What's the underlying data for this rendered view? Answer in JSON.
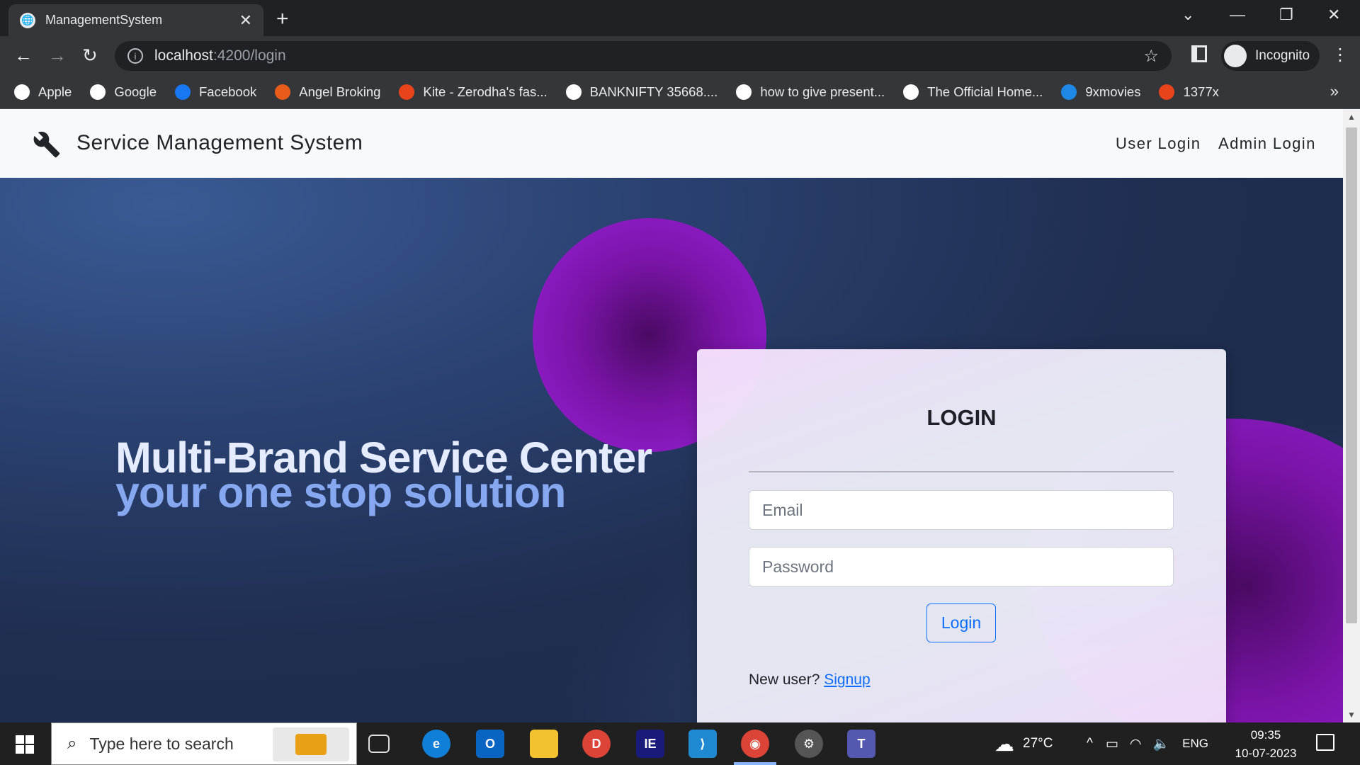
{
  "browser": {
    "tab_title": "ManagementSystem",
    "url_host": "localhost",
    "url_path": ":4200/login",
    "profile_label": "Incognito"
  },
  "bookmarks": [
    {
      "label": "Apple",
      "icon": "apple-icon",
      "color": "#ffffff"
    },
    {
      "label": "Google",
      "icon": "google-icon",
      "color": "#ffffff"
    },
    {
      "label": "Facebook",
      "icon": "facebook-icon",
      "color": "#1877f2"
    },
    {
      "label": "Angel Broking",
      "icon": "angel-broking-icon",
      "color": "#e85c1a"
    },
    {
      "label": "Kite - Zerodha's fas...",
      "icon": "kite-icon",
      "color": "#e8431a"
    },
    {
      "label": "BANKNIFTY 35668....",
      "icon": "tradingview-icon",
      "color": "#ffffff"
    },
    {
      "label": "how to give present...",
      "icon": "google-icon",
      "color": "#ffffff"
    },
    {
      "label": "The Official Home...",
      "icon": "official-home-icon",
      "color": "#ffffff"
    },
    {
      "label": "9xmovies",
      "icon": "play-icon",
      "color": "#1e88e5"
    },
    {
      "label": "1377x",
      "icon": "x-icon",
      "color": "#e8431a"
    }
  ],
  "page": {
    "brand": "Service Management System",
    "nav_user_login": "User Login",
    "nav_admin_login": "Admin Login",
    "headline_1": "Multi-Brand Service Center",
    "headline_2": "your one stop solution",
    "login_title": "LOGIN",
    "email_placeholder": "Email",
    "password_placeholder": "Password",
    "login_button": "Login",
    "new_user_text": "New user?",
    "signup_link": "Signup"
  },
  "taskbar": {
    "search_placeholder": "Type here to search",
    "temperature": "27°C",
    "language": "ENG",
    "time": "09:35",
    "date": "10-07-2023"
  },
  "colors": {
    "accent": "#0d6efd",
    "hero_bg": "#1f2d4f",
    "blob": "#9a22d8",
    "headline_1": "#e6ecff",
    "headline_2": "#86a8f0"
  }
}
